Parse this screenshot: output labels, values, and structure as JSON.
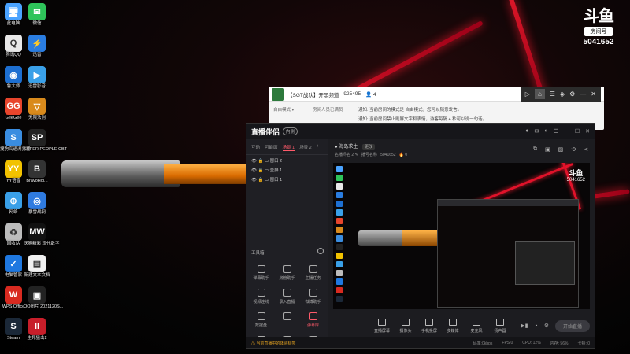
{
  "desktop_icons": [
    {
      "label": "此电脑",
      "color": "#4aa3ff",
      "glyph": "🖥"
    },
    {
      "label": "微信",
      "color": "#2ec45a",
      "glyph": "✉"
    },
    {
      "label": "腾讯QQ",
      "color": "#e8e8e8",
      "glyph": "Q"
    },
    {
      "label": "迅雷",
      "color": "#2a7de1",
      "glyph": "⚡"
    },
    {
      "label": "鲁大师",
      "color": "#1d6fd1",
      "glyph": "◉"
    },
    {
      "label": "迅雷影音",
      "color": "#3aa0e8",
      "glyph": "▶"
    },
    {
      "label": "GeeGee",
      "color": "#e8452c",
      "glyph": "GG"
    },
    {
      "label": "无限法则",
      "color": "#d98a1c",
      "glyph": "▽"
    },
    {
      "label": "搜狗高速浏览器",
      "color": "#3a8de0",
      "glyph": "S"
    },
    {
      "label": "SUPER PEOPLE CBT",
      "color": "#222222",
      "glyph": "SP"
    },
    {
      "label": "YY语音",
      "color": "#f2c200",
      "glyph": "YY"
    },
    {
      "label": "BravoHol...",
      "color": "#333333",
      "glyph": "B"
    },
    {
      "label": "网络",
      "color": "#3aa0e8",
      "glyph": "⊕"
    },
    {
      "label": "暴雪战网",
      "color": "#2f7be0",
      "glyph": "◎"
    },
    {
      "label": "回收站",
      "color": "#bcbcbc",
      "glyph": "♻"
    },
    {
      "label": "沃腾精彩 现代数字",
      "color": "#111111",
      "glyph": "MW"
    },
    {
      "label": "电脑管家",
      "color": "#1f78e0",
      "glyph": "✓"
    },
    {
      "label": "新建文本文档",
      "color": "#f0f0f0",
      "glyph": "▤"
    },
    {
      "label": "WPS Office",
      "color": "#d82a20",
      "glyph": "W"
    },
    {
      "label": "QQ图片 2021120S...",
      "color": "#222222",
      "glyph": "▣"
    },
    {
      "label": "Steam",
      "color": "#1b2838",
      "glyph": "S"
    },
    {
      "label": "生死狙击2",
      "color": "#c81e2a",
      "glyph": "II"
    }
  ],
  "douyu": {
    "mark": "斗鱼",
    "tag": "房间号",
    "room": "5041652"
  },
  "back_window": {
    "title": "【SGT战队】开黑频道",
    "id": "925495",
    "count": "4",
    "side": [
      "自由模式 ▾",
      "房间人员已满员"
    ],
    "msgs": [
      "通知: 当前房间的模式是 自由模式，您可以随意发言。",
      "通知: 当前房间禁止刷屏文字和表情，游客每隔 4 秒可以说一句话。"
    ]
  },
  "main_window": {
    "logo": "直播伴侣",
    "beta": "内测",
    "tabs": [
      "互动",
      "可能面",
      "场景 1",
      "场景 2"
    ],
    "scenes": [
      "窗口 2",
      "全屏 1",
      "窗口 1"
    ],
    "tools_title": "工具箱",
    "tools": [
      "弹幕助手",
      "房管助手",
      "主播任务",
      "视频连线",
      "录入直播",
      "微博助手",
      "数据盘",
      "",
      "弹幕库",
      "",
      "",
      ""
    ],
    "stream": {
      "title": "海岛求生",
      "tag": "更改",
      "sub": "名播间名 2",
      "sub2": "播号名称",
      "room": "5041652",
      "heat": "0"
    },
    "preview_logo_room": "5041652",
    "bottom": [
      "直播屏幕",
      "摄像头",
      "手机投屏",
      "多媒体",
      "麦克风",
      "扬声器"
    ],
    "live_btn": "开始直播",
    "status": [
      "当前直播中的体验标签",
      "码率:0kbps",
      "FPS:0",
      "CPU: 12%",
      "内存: 56%",
      "卡顿: 0"
    ]
  }
}
